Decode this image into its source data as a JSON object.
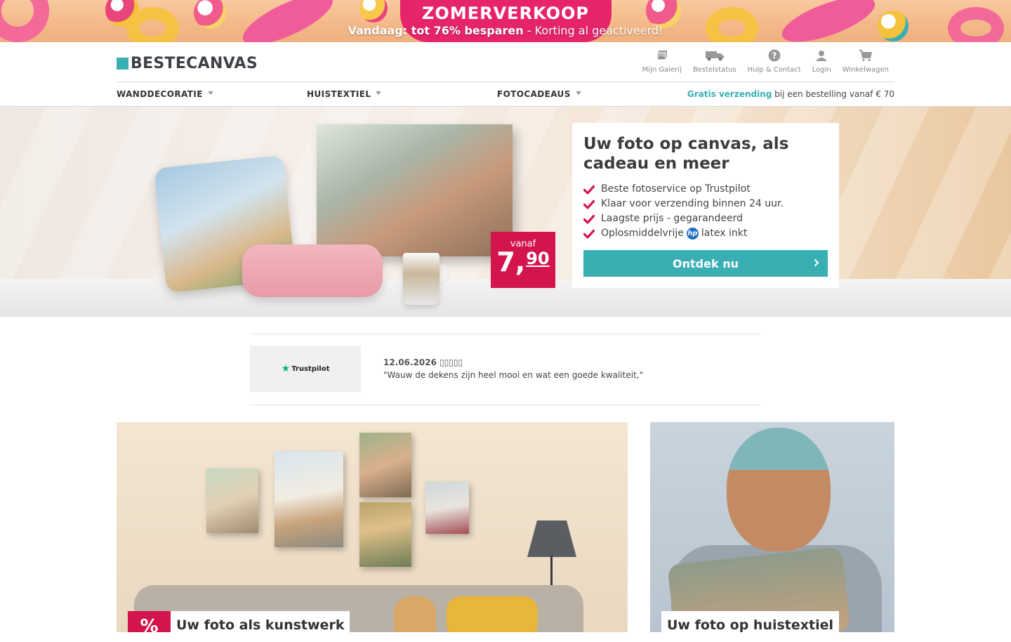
{
  "promo": {
    "title": "ZOMERVERKOOP",
    "subtitle_bold": "Vandaag: tot 76% besparen",
    "subtitle_rest": " - Korting al geactiveerd!"
  },
  "brand": {
    "name": "BESTECANVAS"
  },
  "header_links": [
    {
      "label": "Mijn Galerij",
      "icon": "gallery-icon"
    },
    {
      "label": "Bestelstatus",
      "icon": "truck-icon"
    },
    {
      "label": "Hulp & Contact",
      "icon": "help-icon"
    },
    {
      "label": "Login",
      "icon": "user-icon"
    },
    {
      "label": "Winkelwagen",
      "icon": "cart-icon"
    }
  ],
  "nav": {
    "items": [
      "WANDDECORATIE",
      "HUISTEXTIEL",
      "FOTOCADEAUS"
    ],
    "shipping_bold": "Gratis verzending",
    "shipping_rest": " bij een bestelling vanaf € 70"
  },
  "hero": {
    "price_from": "vanaf",
    "price_euros": "7,",
    "price_cents": "90",
    "title": "Uw foto op canvas, als cadeau en meer",
    "usps": [
      "Beste fotoservice op Trustpilot",
      "Klaar voor verzending binnen 24 uur.",
      "Laagste prijs - gegarandeerd"
    ],
    "usp_ink_before": "Oplosmiddelvrije",
    "usp_ink_logo": "hp",
    "usp_ink_after": "latex inkt",
    "cta": "Ontdek nu"
  },
  "review": {
    "logo": "Trustpilot",
    "date": "12.06.2026",
    "stars": "▯▯▯▯▯",
    "text": "\"Wauw de dekens zijn heel mooi en wat een goede kwaliteit,\""
  },
  "tiles": {
    "left_badge": "%",
    "left_label": "Uw foto als kunstwerk",
    "right_label": "Uw foto op huistextiel"
  },
  "colors": {
    "accent": "#3aafb3",
    "brand_pink": "#d3144d",
    "promo_pink": "#e6246c"
  }
}
